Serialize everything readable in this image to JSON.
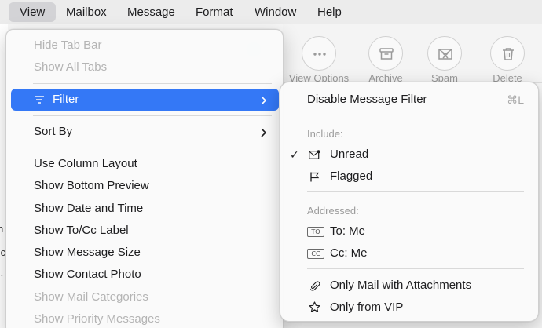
{
  "menubar": {
    "items": [
      "View",
      "Mailbox",
      "Message",
      "Format",
      "Window",
      "Help"
    ]
  },
  "toolbar": {
    "view_options": "View Options",
    "archive": "Archive",
    "spam": "Spam",
    "delete": "Delete"
  },
  "view_menu": {
    "hide_tab_bar": "Hide Tab Bar",
    "show_all_tabs": "Show All Tabs",
    "filter": "Filter",
    "sort_by": "Sort By",
    "use_column_layout": "Use Column Layout",
    "show_bottom_preview": "Show Bottom Preview",
    "show_date_and_time": "Show Date and Time",
    "show_to_cc_label": "Show To/Cc Label",
    "show_message_size": "Show Message Size",
    "show_contact_photo": "Show Contact Photo",
    "show_mail_categories": "Show Mail Categories",
    "show_priority_messages": "Show Priority Messages"
  },
  "filter_menu": {
    "disable_filter": "Disable Message Filter",
    "disable_filter_shortcut": "⌘L",
    "include_label": "Include:",
    "unread": "Unread",
    "unread_checked": "✓",
    "flagged": "Flagged",
    "addressed_label": "Addressed:",
    "to_me": "To: Me",
    "to_tag": "TO",
    "cc_me": "Cc: Me",
    "cc_tag": "CC",
    "only_attachments": "Only Mail with Attachments",
    "only_vip": "Only from VIP"
  },
  "background": {
    "cutoff_chars": [
      "n",
      ".c",
      "ı."
    ]
  },
  "colors": {
    "highlight": "#3478f6",
    "menubar_bg": "#ececec",
    "active_menu_bg": "#d3d3d6"
  }
}
